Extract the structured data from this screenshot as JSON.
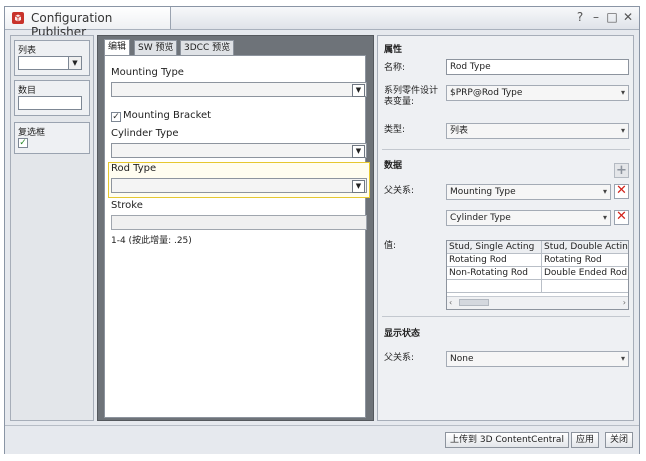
{
  "window": {
    "title": "Configuration Publisher",
    "help": "?",
    "minimize": "–",
    "maximize": "□",
    "close": "✕"
  },
  "left_panel": {
    "list_label": "列表",
    "number_label": "数目",
    "checkbox_label": "复选框",
    "checkbox_mark": "✓"
  },
  "tabs": [
    {
      "label": "编辑"
    },
    {
      "label": "SW 预览"
    },
    {
      "label": "3DCC 预览"
    }
  ],
  "form": {
    "mounting_type_label": "Mounting Type",
    "mounting_bracket_label": "Mounting Bracket",
    "mounting_bracket_check": "✓",
    "cylinder_type_label": "Cylinder Type",
    "rod_type_label": "Rod Type",
    "stroke_label": "Stroke",
    "stroke_hint": "1-4 (按此增量: .25)",
    "dropdown_arrow": "▼"
  },
  "properties": {
    "section_title": "属性",
    "name_label": "名称:",
    "name_value": "Rod Type",
    "variable_label": "系列零件设计表变量:",
    "variable_value": "$PRP@Rod Type",
    "type_label": "类型:",
    "type_value": "列表",
    "arrow": "▾"
  },
  "data_section": {
    "title": "数据",
    "plus": "+",
    "parent_label": "父关系:",
    "parent1": "Mounting Type",
    "parent2": "Cylinder Type",
    "delete_mark": "✕",
    "value_label": "值:",
    "grid_headers": [
      "Stud,   Single Acting",
      "Stud,   Double Actin"
    ],
    "grid_rows": [
      [
        "Rotating Rod",
        "Rotating Rod"
      ],
      [
        "Non-Rotating Rod",
        "Double Ended Rod"
      ]
    ],
    "scroll_left": "‹",
    "scroll_right": "›"
  },
  "display_state": {
    "title": "显示状态",
    "parent_label": "父关系:",
    "parent_value": "None"
  },
  "buttons": {
    "upload": "上传到 3D ContentCentral",
    "apply": "应用",
    "close": "关闭"
  },
  "colors": {
    "highlight_border": "#e6c830",
    "delete_red": "#d2231b",
    "preview_dark": "#6e7379"
  }
}
